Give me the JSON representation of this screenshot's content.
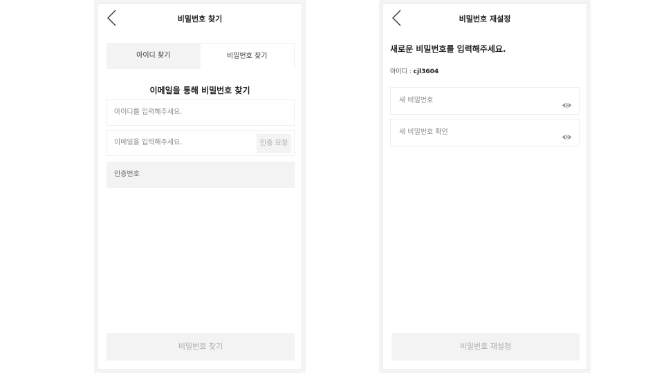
{
  "find_password": {
    "header_title": "비밀번호 찾기",
    "tabs": [
      {
        "label": "아이디 찾기",
        "active": false
      },
      {
        "label": "비밀번호 찾기",
        "active": true
      }
    ],
    "section_title": "이메일을 통해 비밀번호 찾기",
    "id_placeholder": "아이디를 입력해주세요.",
    "email_placeholder": "이메일을 입력해주세요.",
    "request_code_label": "인증 요청",
    "code_placeholder": "인증번호",
    "submit_label": "비밀번호 찾기"
  },
  "reset_password": {
    "header_title": "비밀번호 재설정",
    "prompt": "새로운 비밀번호를 입력해주세요.",
    "id_label": "아이디 : ",
    "id_value": "cjl3604",
    "new_password_placeholder": "새 비밀번호",
    "confirm_password_placeholder": "새 비밀번호 확인",
    "submit_label": "비밀번호 재설정"
  },
  "icons": {
    "back": "chevron-left-icon",
    "visibility": "eye-icon"
  },
  "colors": {
    "field_border": "#eeeeee",
    "gray_fill": "#f3f3f3",
    "disabled_text": "#aaaaaa"
  }
}
